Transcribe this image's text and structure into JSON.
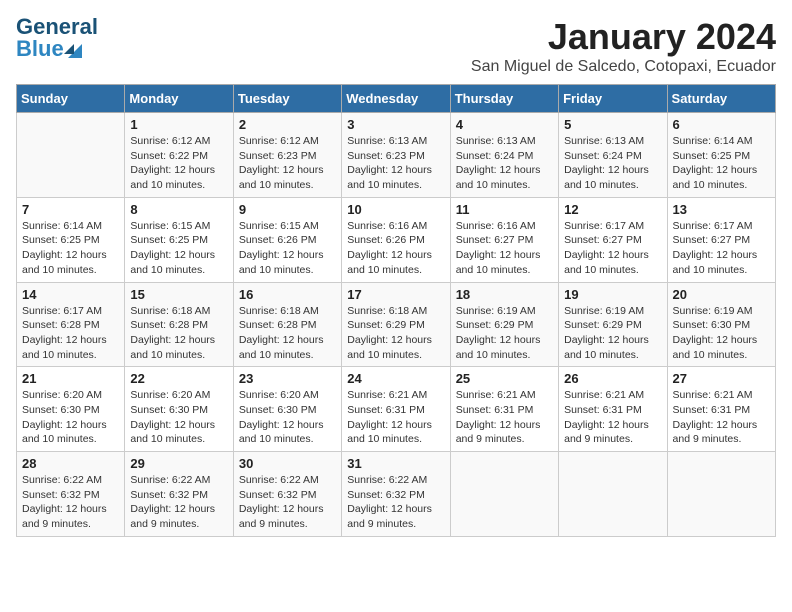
{
  "header": {
    "logo_line1": "General",
    "logo_line2": "Blue",
    "title": "January 2024",
    "subtitle": "San Miguel de Salcedo, Cotopaxi, Ecuador"
  },
  "days_of_week": [
    "Sunday",
    "Monday",
    "Tuesday",
    "Wednesday",
    "Thursday",
    "Friday",
    "Saturday"
  ],
  "weeks": [
    [
      {
        "day": "",
        "info": ""
      },
      {
        "day": "1",
        "info": "Sunrise: 6:12 AM\nSunset: 6:22 PM\nDaylight: 12 hours\nand 10 minutes."
      },
      {
        "day": "2",
        "info": "Sunrise: 6:12 AM\nSunset: 6:23 PM\nDaylight: 12 hours\nand 10 minutes."
      },
      {
        "day": "3",
        "info": "Sunrise: 6:13 AM\nSunset: 6:23 PM\nDaylight: 12 hours\nand 10 minutes."
      },
      {
        "day": "4",
        "info": "Sunrise: 6:13 AM\nSunset: 6:24 PM\nDaylight: 12 hours\nand 10 minutes."
      },
      {
        "day": "5",
        "info": "Sunrise: 6:13 AM\nSunset: 6:24 PM\nDaylight: 12 hours\nand 10 minutes."
      },
      {
        "day": "6",
        "info": "Sunrise: 6:14 AM\nSunset: 6:25 PM\nDaylight: 12 hours\nand 10 minutes."
      }
    ],
    [
      {
        "day": "7",
        "info": "Sunrise: 6:14 AM\nSunset: 6:25 PM\nDaylight: 12 hours\nand 10 minutes."
      },
      {
        "day": "8",
        "info": "Sunrise: 6:15 AM\nSunset: 6:25 PM\nDaylight: 12 hours\nand 10 minutes."
      },
      {
        "day": "9",
        "info": "Sunrise: 6:15 AM\nSunset: 6:26 PM\nDaylight: 12 hours\nand 10 minutes."
      },
      {
        "day": "10",
        "info": "Sunrise: 6:16 AM\nSunset: 6:26 PM\nDaylight: 12 hours\nand 10 minutes."
      },
      {
        "day": "11",
        "info": "Sunrise: 6:16 AM\nSunset: 6:27 PM\nDaylight: 12 hours\nand 10 minutes."
      },
      {
        "day": "12",
        "info": "Sunrise: 6:17 AM\nSunset: 6:27 PM\nDaylight: 12 hours\nand 10 minutes."
      },
      {
        "day": "13",
        "info": "Sunrise: 6:17 AM\nSunset: 6:27 PM\nDaylight: 12 hours\nand 10 minutes."
      }
    ],
    [
      {
        "day": "14",
        "info": "Sunrise: 6:17 AM\nSunset: 6:28 PM\nDaylight: 12 hours\nand 10 minutes."
      },
      {
        "day": "15",
        "info": "Sunrise: 6:18 AM\nSunset: 6:28 PM\nDaylight: 12 hours\nand 10 minutes."
      },
      {
        "day": "16",
        "info": "Sunrise: 6:18 AM\nSunset: 6:28 PM\nDaylight: 12 hours\nand 10 minutes."
      },
      {
        "day": "17",
        "info": "Sunrise: 6:18 AM\nSunset: 6:29 PM\nDaylight: 12 hours\nand 10 minutes."
      },
      {
        "day": "18",
        "info": "Sunrise: 6:19 AM\nSunset: 6:29 PM\nDaylight: 12 hours\nand 10 minutes."
      },
      {
        "day": "19",
        "info": "Sunrise: 6:19 AM\nSunset: 6:29 PM\nDaylight: 12 hours\nand 10 minutes."
      },
      {
        "day": "20",
        "info": "Sunrise: 6:19 AM\nSunset: 6:30 PM\nDaylight: 12 hours\nand 10 minutes."
      }
    ],
    [
      {
        "day": "21",
        "info": "Sunrise: 6:20 AM\nSunset: 6:30 PM\nDaylight: 12 hours\nand 10 minutes."
      },
      {
        "day": "22",
        "info": "Sunrise: 6:20 AM\nSunset: 6:30 PM\nDaylight: 12 hours\nand 10 minutes."
      },
      {
        "day": "23",
        "info": "Sunrise: 6:20 AM\nSunset: 6:30 PM\nDaylight: 12 hours\nand 10 minutes."
      },
      {
        "day": "24",
        "info": "Sunrise: 6:21 AM\nSunset: 6:31 PM\nDaylight: 12 hours\nand 10 minutes."
      },
      {
        "day": "25",
        "info": "Sunrise: 6:21 AM\nSunset: 6:31 PM\nDaylight: 12 hours\nand 9 minutes."
      },
      {
        "day": "26",
        "info": "Sunrise: 6:21 AM\nSunset: 6:31 PM\nDaylight: 12 hours\nand 9 minutes."
      },
      {
        "day": "27",
        "info": "Sunrise: 6:21 AM\nSunset: 6:31 PM\nDaylight: 12 hours\nand 9 minutes."
      }
    ],
    [
      {
        "day": "28",
        "info": "Sunrise: 6:22 AM\nSunset: 6:32 PM\nDaylight: 12 hours\nand 9 minutes."
      },
      {
        "day": "29",
        "info": "Sunrise: 6:22 AM\nSunset: 6:32 PM\nDaylight: 12 hours\nand 9 minutes."
      },
      {
        "day": "30",
        "info": "Sunrise: 6:22 AM\nSunset: 6:32 PM\nDaylight: 12 hours\nand 9 minutes."
      },
      {
        "day": "31",
        "info": "Sunrise: 6:22 AM\nSunset: 6:32 PM\nDaylight: 12 hours\nand 9 minutes."
      },
      {
        "day": "",
        "info": ""
      },
      {
        "day": "",
        "info": ""
      },
      {
        "day": "",
        "info": ""
      }
    ]
  ]
}
